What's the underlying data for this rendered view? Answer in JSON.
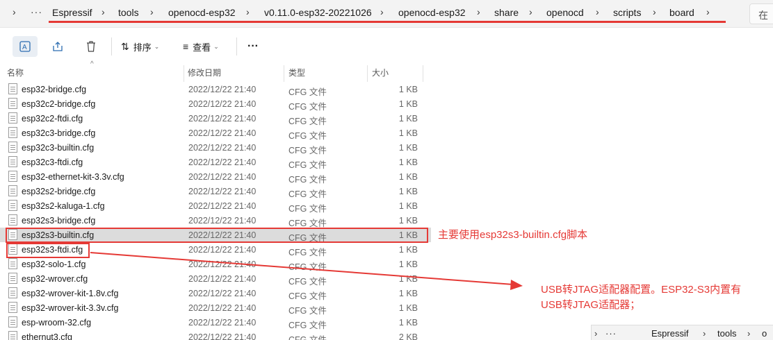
{
  "breadcrumb": {
    "items": [
      "Espressif",
      "tools",
      "openocd-esp32",
      "v0.11.0-esp32-20221026",
      "openocd-esp32",
      "share",
      "openocd",
      "scripts",
      "board"
    ],
    "search_label": "在"
  },
  "toolbar": {
    "sort_label": "排序",
    "view_label": "查看",
    "more_label": "···"
  },
  "columns": {
    "name": "名称",
    "modified": "修改日期",
    "type": "类型",
    "size": "大小"
  },
  "files": [
    {
      "name": "esp32-bridge.cfg",
      "modified": "2022/12/22 21:40",
      "type": "CFG 文件",
      "size": "1 KB"
    },
    {
      "name": "esp32c2-bridge.cfg",
      "modified": "2022/12/22 21:40",
      "type": "CFG 文件",
      "size": "1 KB"
    },
    {
      "name": "esp32c2-ftdi.cfg",
      "modified": "2022/12/22 21:40",
      "type": "CFG 文件",
      "size": "1 KB"
    },
    {
      "name": "esp32c3-bridge.cfg",
      "modified": "2022/12/22 21:40",
      "type": "CFG 文件",
      "size": "1 KB"
    },
    {
      "name": "esp32c3-builtin.cfg",
      "modified": "2022/12/22 21:40",
      "type": "CFG 文件",
      "size": "1 KB"
    },
    {
      "name": "esp32c3-ftdi.cfg",
      "modified": "2022/12/22 21:40",
      "type": "CFG 文件",
      "size": "1 KB"
    },
    {
      "name": "esp32-ethernet-kit-3.3v.cfg",
      "modified": "2022/12/22 21:40",
      "type": "CFG 文件",
      "size": "1 KB"
    },
    {
      "name": "esp32s2-bridge.cfg",
      "modified": "2022/12/22 21:40",
      "type": "CFG 文件",
      "size": "1 KB"
    },
    {
      "name": "esp32s2-kaluga-1.cfg",
      "modified": "2022/12/22 21:40",
      "type": "CFG 文件",
      "size": "1 KB"
    },
    {
      "name": "esp32s3-bridge.cfg",
      "modified": "2022/12/22 21:40",
      "type": "CFG 文件",
      "size": "1 KB"
    },
    {
      "name": "esp32s3-builtin.cfg",
      "modified": "2022/12/22 21:40",
      "type": "CFG 文件",
      "size": "1 KB"
    },
    {
      "name": "esp32s3-ftdi.cfg",
      "modified": "2022/12/22 21:40",
      "type": "CFG 文件",
      "size": "1 KB"
    },
    {
      "name": "esp32-solo-1.cfg",
      "modified": "2022/12/22 21:40",
      "type": "CFG 文件",
      "size": "1 KB"
    },
    {
      "name": "esp32-wrover.cfg",
      "modified": "2022/12/22 21:40",
      "type": "CFG 文件",
      "size": "1 KB"
    },
    {
      "name": "esp32-wrover-kit-1.8v.cfg",
      "modified": "2022/12/22 21:40",
      "type": "CFG 文件",
      "size": "1 KB"
    },
    {
      "name": "esp32-wrover-kit-3.3v.cfg",
      "modified": "2022/12/22 21:40",
      "type": "CFG 文件",
      "size": "1 KB"
    },
    {
      "name": "esp-wroom-32.cfg",
      "modified": "2022/12/22 21:40",
      "type": "CFG 文件",
      "size": "1 KB"
    },
    {
      "name": "ethernut3.cfg",
      "modified": "2022/12/22 21:40",
      "type": "CFG 文件",
      "size": "2 KB"
    }
  ],
  "annotations": {
    "note1": "主要使用esp32s3-builtin.cfg脚本",
    "note2_line1": "USB转JTAG适配器配置。ESP32-S3内置有",
    "note2_line2": "USB转JTAG适配器；",
    "color": "#e53935"
  },
  "mini_window": {
    "crumbs": [
      "Espressif",
      "tools",
      "o"
    ]
  }
}
